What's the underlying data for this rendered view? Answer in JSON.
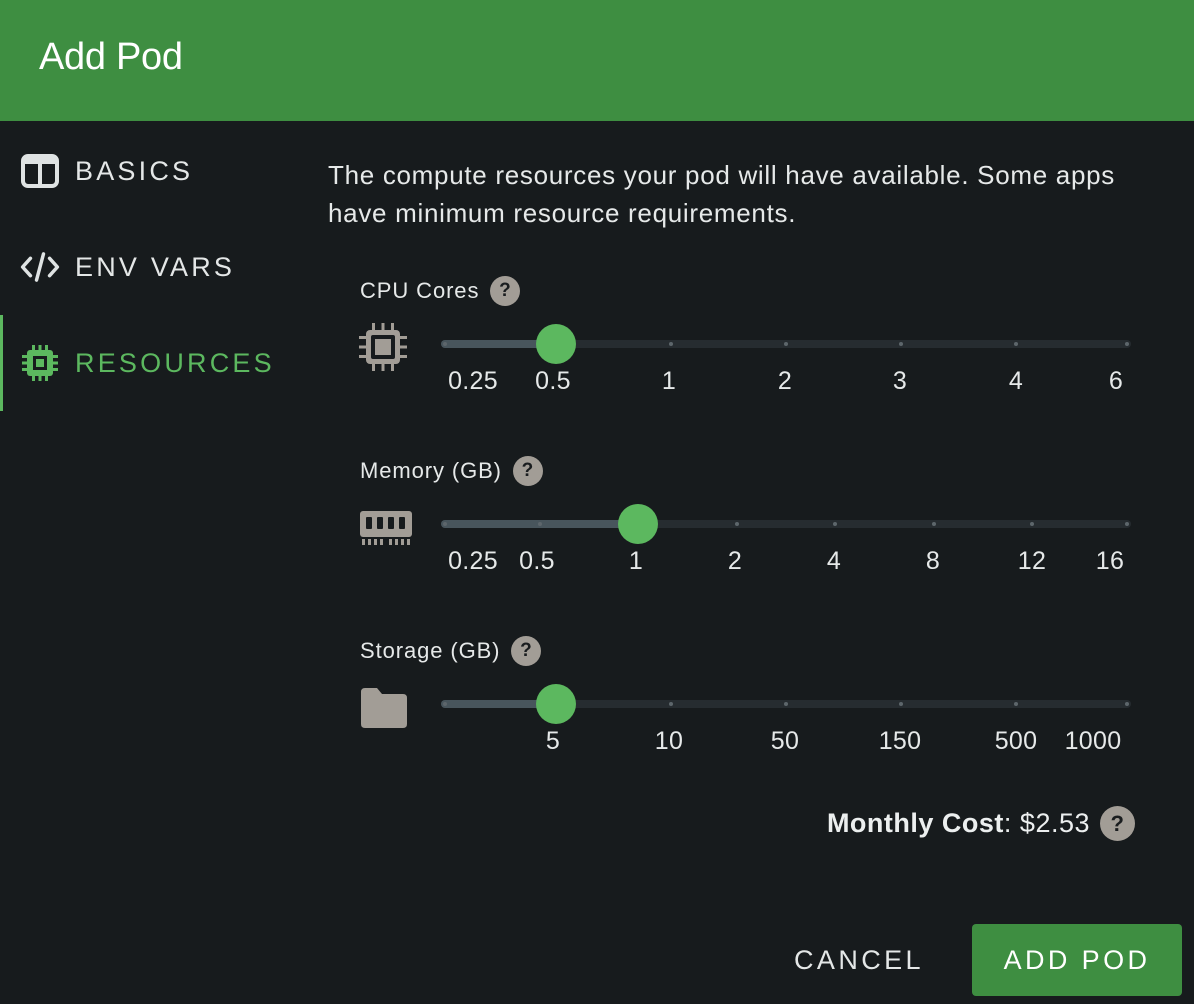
{
  "dialog": {
    "title": "Add Pod"
  },
  "sidebar": {
    "items": [
      {
        "label": "BASICS",
        "icon": "columns-icon",
        "active": false
      },
      {
        "label": "ENV VARS",
        "icon": "code-icon",
        "active": false
      },
      {
        "label": "RESOURCES",
        "icon": "chip-icon",
        "active": true
      }
    ]
  },
  "resources": {
    "intro": "The compute resources your pod will have available. Some apps have minimum resource requirements.",
    "cpu": {
      "label": "CPU Cores",
      "help": "?",
      "icon": "cpu-icon",
      "ticks": [
        "0.25",
        "0.5",
        "1",
        "2",
        "3",
        "4",
        "6"
      ],
      "value": "0.5"
    },
    "memory": {
      "label": "Memory (GB)",
      "help": "?",
      "icon": "memory-icon",
      "ticks": [
        "0.25",
        "0.5",
        "1",
        "2",
        "4",
        "8",
        "12",
        "16"
      ],
      "value": "1"
    },
    "storage": {
      "label": "Storage (GB)",
      "help": "?",
      "icon": "folder-icon",
      "ticks": [
        "5",
        "10",
        "50",
        "150",
        "500",
        "1000"
      ],
      "value": "5"
    }
  },
  "cost": {
    "label": "Monthly Cost",
    "value": ": $2.53",
    "help": "?"
  },
  "footer": {
    "cancel_label": "CANCEL",
    "add_label": "ADD POD"
  },
  "colors": {
    "accent": "#3e8e41",
    "active": "#5cb85f",
    "background": "#171b1d"
  }
}
